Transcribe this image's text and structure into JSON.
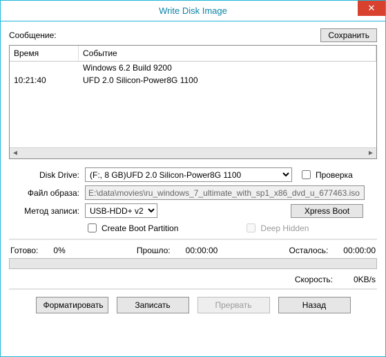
{
  "window": {
    "title": "Write Disk Image"
  },
  "message": {
    "label": "Сообщение:",
    "save_button": "Сохранить"
  },
  "log": {
    "columns": {
      "time": "Время",
      "event": "Событие"
    },
    "rows": [
      {
        "time": "",
        "event": "Windows 6.2 Build 9200"
      },
      {
        "time": "10:21:40",
        "event": "UFD 2.0 Silicon-Power8G 1100"
      }
    ]
  },
  "form": {
    "disk_drive": {
      "label": "Disk Drive:",
      "value": "(F:, 8 GB)UFD 2.0 Silicon-Power8G 1100",
      "check_label": "Проверка"
    },
    "image_file": {
      "label": "Файл образа:",
      "value": "E:\\data\\movies\\ru_windows_7_ultimate_with_sp1_x86_dvd_u_677463.iso"
    },
    "write_method": {
      "label": "Метод записи:",
      "value": "USB-HDD+ v2",
      "xpress_boot_button": "Xpress Boot"
    },
    "create_boot_label": "Create Boot Partition",
    "deep_hidden_label": "Deep Hidden"
  },
  "status": {
    "ready_label": "Готово:",
    "ready_value": "0%",
    "elapsed_label": "Прошло:",
    "elapsed_value": "00:00:00",
    "remain_label": "Осталось:",
    "remain_value": "00:00:00",
    "speed_label": "Скорость:",
    "speed_value": "0KB/s"
  },
  "buttons": {
    "format": "Форматировать",
    "write": "Записать",
    "abort": "Прервать",
    "back": "Назад"
  }
}
